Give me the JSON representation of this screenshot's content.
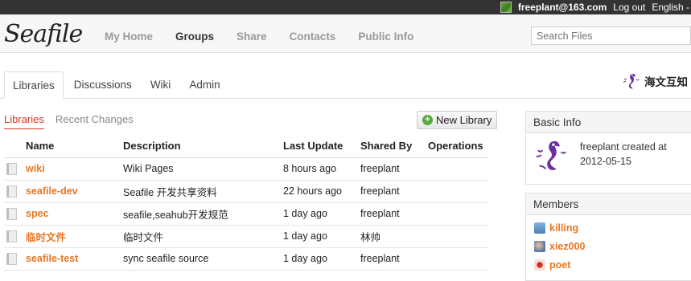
{
  "topbar": {
    "user": "freeplant@163.com",
    "logout": "Log out",
    "language": "English -"
  },
  "header": {
    "logo": "Seafile",
    "nav": [
      "My Home",
      "Groups",
      "Share",
      "Contacts",
      "Public Info"
    ],
    "nav_active": "Groups",
    "search_placeholder": "Search Files"
  },
  "tabs": {
    "items": [
      "Libraries",
      "Discussions",
      "Wiki",
      "Admin"
    ],
    "active": "Libraries"
  },
  "group": {
    "name": "海文互知",
    "icon": "seahorse-logo"
  },
  "subtabs": {
    "libraries": "Libraries",
    "recent": "Recent Changes"
  },
  "new_library": "New Library",
  "table": {
    "headers": [
      "Name",
      "Description",
      "Last Update",
      "Shared By",
      "Operations"
    ],
    "rows": [
      {
        "name": "wiki",
        "description": "Wiki Pages",
        "updated": "8 hours ago",
        "shared_by": "freeplant"
      },
      {
        "name": "seafile-dev",
        "description": "Seafile 开发共享资料",
        "updated": "22 hours ago",
        "shared_by": "freeplant"
      },
      {
        "name": "spec",
        "description": "seafile,seahub开发规范",
        "updated": "1 day ago",
        "shared_by": "freeplant"
      },
      {
        "name": "临时文件",
        "description": "临时文件",
        "updated": "1 day ago",
        "shared_by": "林帅"
      },
      {
        "name": "seafile-test",
        "description": "sync seafile source",
        "updated": "1 day ago",
        "shared_by": "freeplant"
      }
    ]
  },
  "basic_info": {
    "title": "Basic Info",
    "line1": "freeplant created at",
    "line2": "2012-05-15"
  },
  "members": {
    "title": "Members",
    "items": [
      {
        "name": "killing",
        "color": "#4a7fb5"
      },
      {
        "name": "xiez000",
        "color": "#5577aa"
      },
      {
        "name": "poet",
        "color": "#cc3322"
      }
    ]
  },
  "colors": {
    "accent": "#e87722",
    "active_subtab": "#e0311a",
    "brand_purple": "#6b2fa0"
  }
}
